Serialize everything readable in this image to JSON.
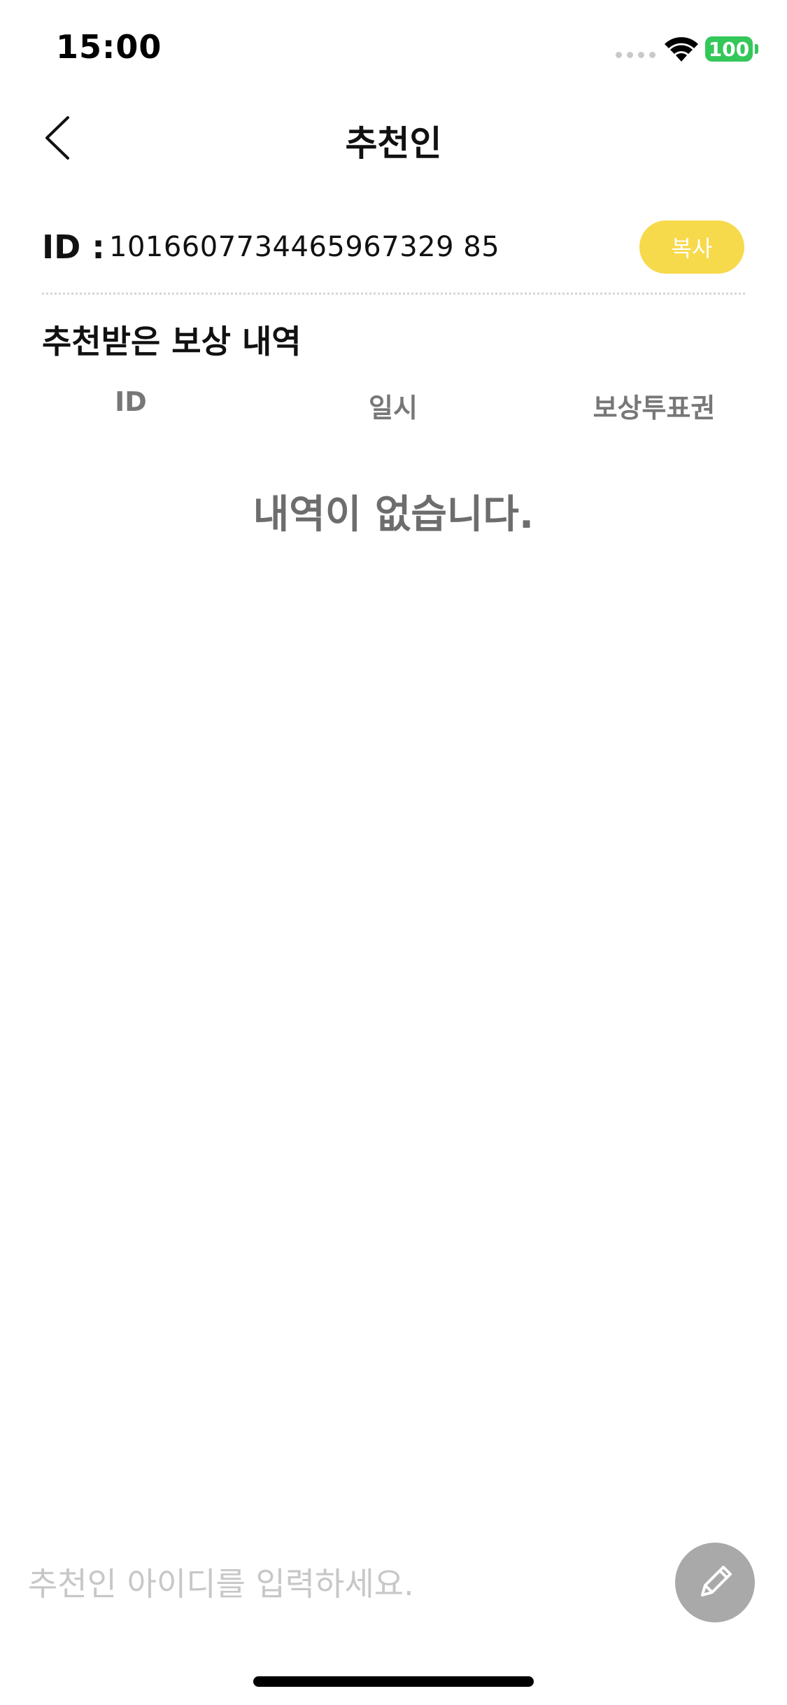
{
  "status_bar": {
    "time": "15:00",
    "battery": "100",
    "battery_color": "#34c759"
  },
  "header": {
    "title": "추천인",
    "back_icon": "chevron-left-icon"
  },
  "referral": {
    "id_label": "ID :",
    "id_value": "1016607734465967329 85",
    "copy_label": "복사",
    "copy_color": "#f7d94c"
  },
  "history": {
    "title": "추천받은 보상 내역",
    "columns": [
      "ID",
      "일시",
      "보상투표권"
    ],
    "rows": [],
    "empty_message": "내역이 없습니다."
  },
  "input": {
    "placeholder": "추천인 아이디를 입력하세요.",
    "value": "",
    "submit_icon": "pencil-icon"
  }
}
